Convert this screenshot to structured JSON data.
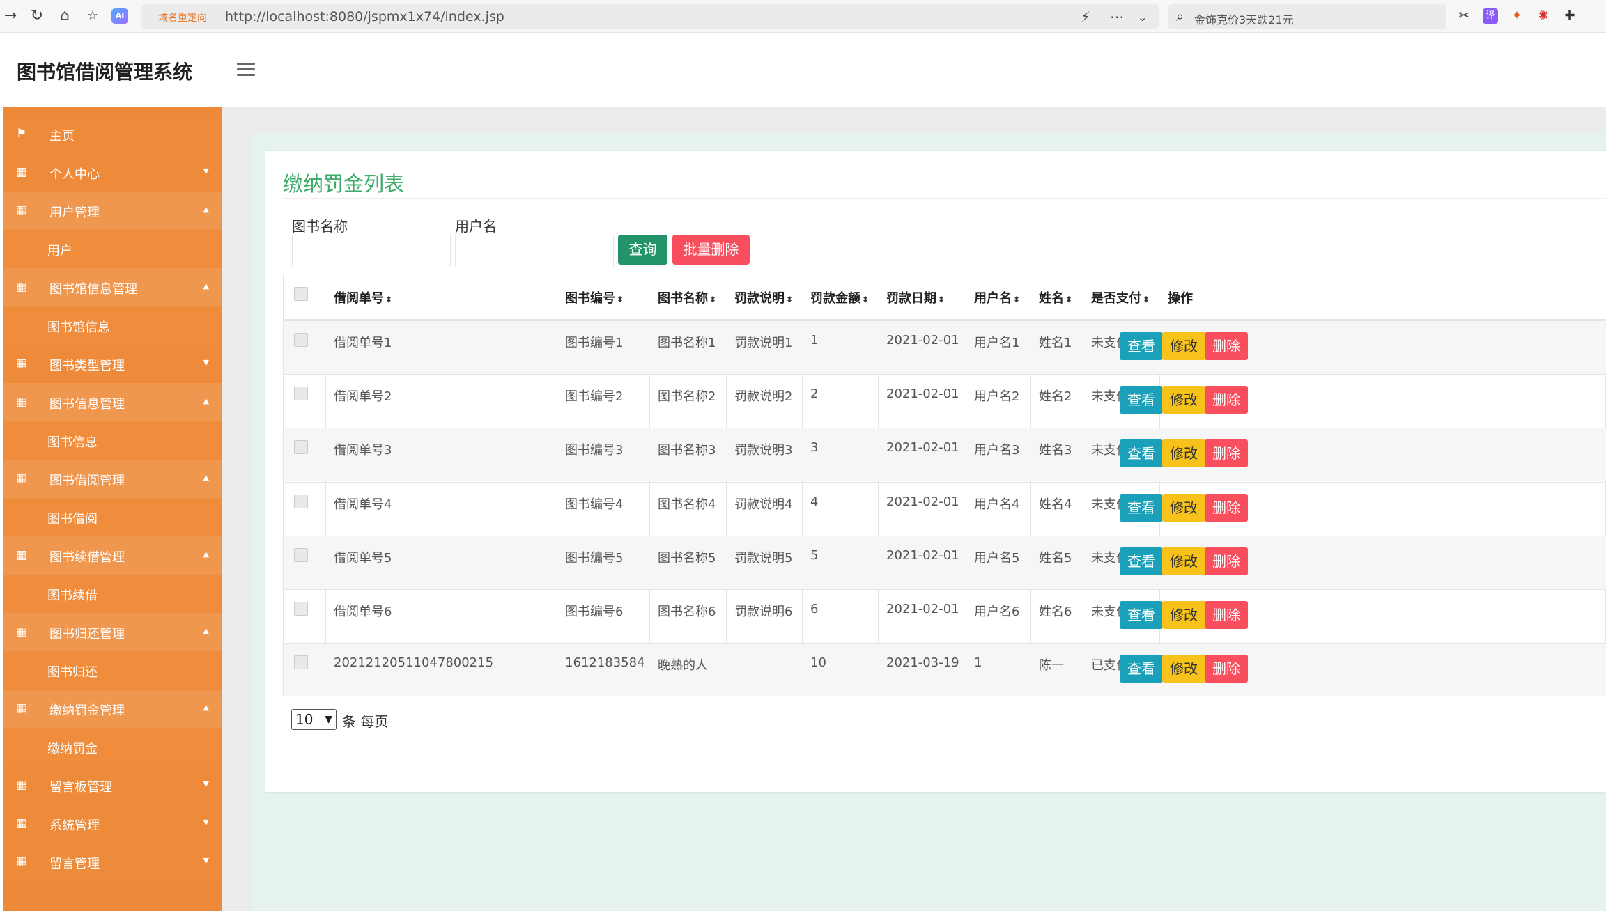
{
  "browser": {
    "redirect_tag": "域名重定向",
    "url": "http://localhost:8080/jspmx1x74/index.jsp",
    "search_text": "金饰克价3天跌21元",
    "ai_label": "AI"
  },
  "app": {
    "title": "图书馆借阅管理系统"
  },
  "sidebar": {
    "items": [
      {
        "label": "主页",
        "type": "home"
      },
      {
        "label": "个人中心",
        "type": "group",
        "caret": "▼"
      },
      {
        "label": "用户管理",
        "type": "open",
        "caret": "▲"
      },
      {
        "label": "用户",
        "type": "sub"
      },
      {
        "label": "图书馆信息管理",
        "type": "open",
        "caret": "▲"
      },
      {
        "label": "图书馆信息",
        "type": "sub"
      },
      {
        "label": "图书类型管理",
        "type": "group",
        "caret": "▼"
      },
      {
        "label": "图书信息管理",
        "type": "open",
        "caret": "▲"
      },
      {
        "label": "图书信息",
        "type": "sub"
      },
      {
        "label": "图书借阅管理",
        "type": "open",
        "caret": "▲"
      },
      {
        "label": "图书借阅",
        "type": "sub"
      },
      {
        "label": "图书续借管理",
        "type": "open",
        "caret": "▲"
      },
      {
        "label": "图书续借",
        "type": "sub"
      },
      {
        "label": "图书归还管理",
        "type": "open",
        "caret": "▲"
      },
      {
        "label": "图书归还",
        "type": "sub"
      },
      {
        "label": "缴纳罚金管理",
        "type": "open",
        "caret": "▲"
      },
      {
        "label": "缴纳罚金",
        "type": "sub"
      },
      {
        "label": "留言板管理",
        "type": "group",
        "caret": "▼"
      },
      {
        "label": "系统管理",
        "type": "group",
        "caret": "▼"
      },
      {
        "label": "留言管理",
        "type": "group",
        "caret": "▼"
      }
    ]
  },
  "page": {
    "title": "缴纳罚金列表",
    "filters": {
      "book_name_label": "图书名称",
      "book_name_value": "",
      "username_label": "用户名",
      "username_value": ""
    },
    "buttons": {
      "search": "查询",
      "batch_delete": "批量删除"
    },
    "table": {
      "columns": [
        "借阅单号",
        "图书编号",
        "图书名称",
        "罚款说明",
        "罚款金额",
        "罚款日期",
        "用户名",
        "姓名",
        "是否支付",
        "操作"
      ],
      "sort_glyph": "⬍",
      "rows": [
        [
          "借阅单号1",
          "图书编号1",
          "图书名称1",
          "罚款说明1",
          "1",
          "2021-02-01",
          "用户名1",
          "姓名1",
          "未支付"
        ],
        [
          "借阅单号2",
          "图书编号2",
          "图书名称2",
          "罚款说明2",
          "2",
          "2021-02-01",
          "用户名2",
          "姓名2",
          "未支付"
        ],
        [
          "借阅单号3",
          "图书编号3",
          "图书名称3",
          "罚款说明3",
          "3",
          "2021-02-01",
          "用户名3",
          "姓名3",
          "未支付"
        ],
        [
          "借阅单号4",
          "图书编号4",
          "图书名称4",
          "罚款说明4",
          "4",
          "2021-02-01",
          "用户名4",
          "姓名4",
          "未支付"
        ],
        [
          "借阅单号5",
          "图书编号5",
          "图书名称5",
          "罚款说明5",
          "5",
          "2021-02-01",
          "用户名5",
          "姓名5",
          "未支付"
        ],
        [
          "借阅单号6",
          "图书编号6",
          "图书名称6",
          "罚款说明6",
          "6",
          "2021-02-01",
          "用户名6",
          "姓名6",
          "未支付"
        ],
        [
          "20212120511047800215",
          "1612183584",
          "晚熟的人",
          "",
          "10",
          "2021-03-19",
          "1",
          "陈一",
          "已支付"
        ]
      ],
      "actions": {
        "view": "查看",
        "edit": "修改",
        "delete": "删除"
      }
    },
    "pagination": {
      "page_size": "10",
      "suffix": "条 每页"
    }
  },
  "colors": {
    "sidebar": "#ed8a3a",
    "title_green": "#3dab6a",
    "search_btn": "#23936a",
    "delete_btn": "#f84e5e",
    "view_btn": "#1aa0b8",
    "edit_btn": "#f7c21a"
  }
}
